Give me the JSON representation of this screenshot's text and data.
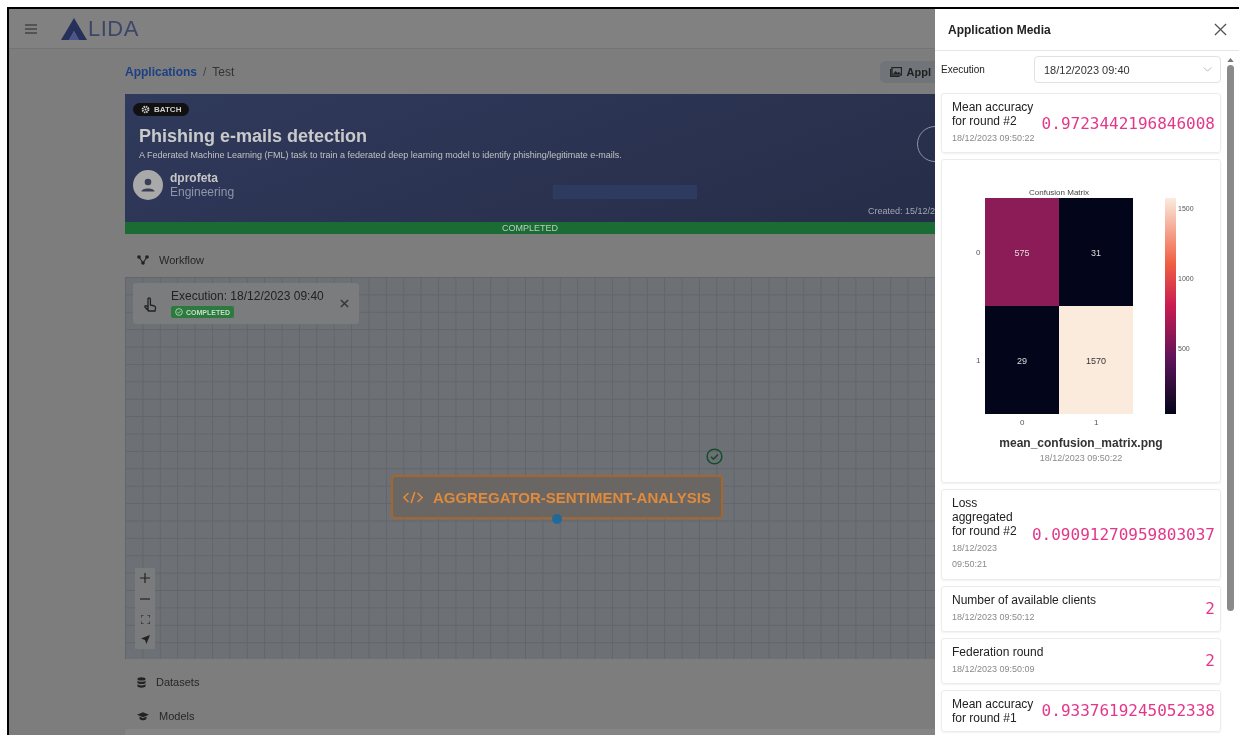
{
  "header": {
    "logo_text": "LIDA"
  },
  "breadcrumb_separator": "/",
  "breadcrumb": [
    {
      "label": "Applications",
      "kind": "link"
    },
    {
      "label": "Test",
      "kind": "current"
    }
  ],
  "media_button": {
    "label": "Appl"
  },
  "application": {
    "type_badge": "BATCH",
    "title": "Phishing e-mails detection",
    "description": "A Federated Machine Learning (FML) task to train a federated deep learning model to identify phishing/legitimate e-mails.",
    "owner": {
      "name": "dprofeta",
      "team": "Engineering"
    },
    "created": "Created: 15/12/2",
    "status": "COMPLETED"
  },
  "workflow": {
    "label": "Workflow",
    "execution": {
      "label": "Execution: 18/12/2023 09:40",
      "status": "COMPLETED"
    },
    "node": {
      "label": "AGGREGATOR-SENTIMENT-ANALYSIS",
      "completed": true
    }
  },
  "sections": [
    {
      "label": "Datasets",
      "kind": "datasets"
    },
    {
      "label": "Models",
      "kind": "models"
    }
  ],
  "media_panel": {
    "title": "Application Media",
    "execution_label": "Execution",
    "execution_value": "18/12/2023 09:40",
    "items": [
      {
        "kind": "metric",
        "label": "Mean accuracy for round #2",
        "value": "0.9723442196846008",
        "date": "18/12/2023 09:50:22"
      },
      {
        "kind": "image",
        "filename": "mean_confusion_matrix.png",
        "date": "18/12/2023 09:50:22",
        "heatmap": {
          "title": "Confusion Matrix",
          "row_labels": [
            "0",
            "1"
          ],
          "col_labels": [
            "0",
            "1"
          ],
          "cells": [
            [
              {
                "value": "575",
                "color": "#8b1c57"
              },
              {
                "value": "31",
                "color": "#03051a"
              }
            ],
            [
              {
                "value": "29",
                "color": "#03051a"
              },
              {
                "value": "1570",
                "color": "#faebdd"
              }
            ]
          ],
          "scale_ticks": [
            "1500",
            "1000",
            "500"
          ]
        }
      },
      {
        "kind": "metric",
        "label": "Loss aggregated for round #2",
        "value": "0.09091270959803037",
        "date": "18/12/2023 09:50:21"
      },
      {
        "kind": "metric",
        "label": "Number of available clients",
        "value": "2",
        "date": "18/12/2023 09:50:12"
      },
      {
        "kind": "metric",
        "label": "Federation round",
        "value": "2",
        "date": "18/12/2023 09:50:09"
      },
      {
        "kind": "metric",
        "label": "Mean accuracy for round #1",
        "value": "0.9337619245052338"
      }
    ]
  }
}
